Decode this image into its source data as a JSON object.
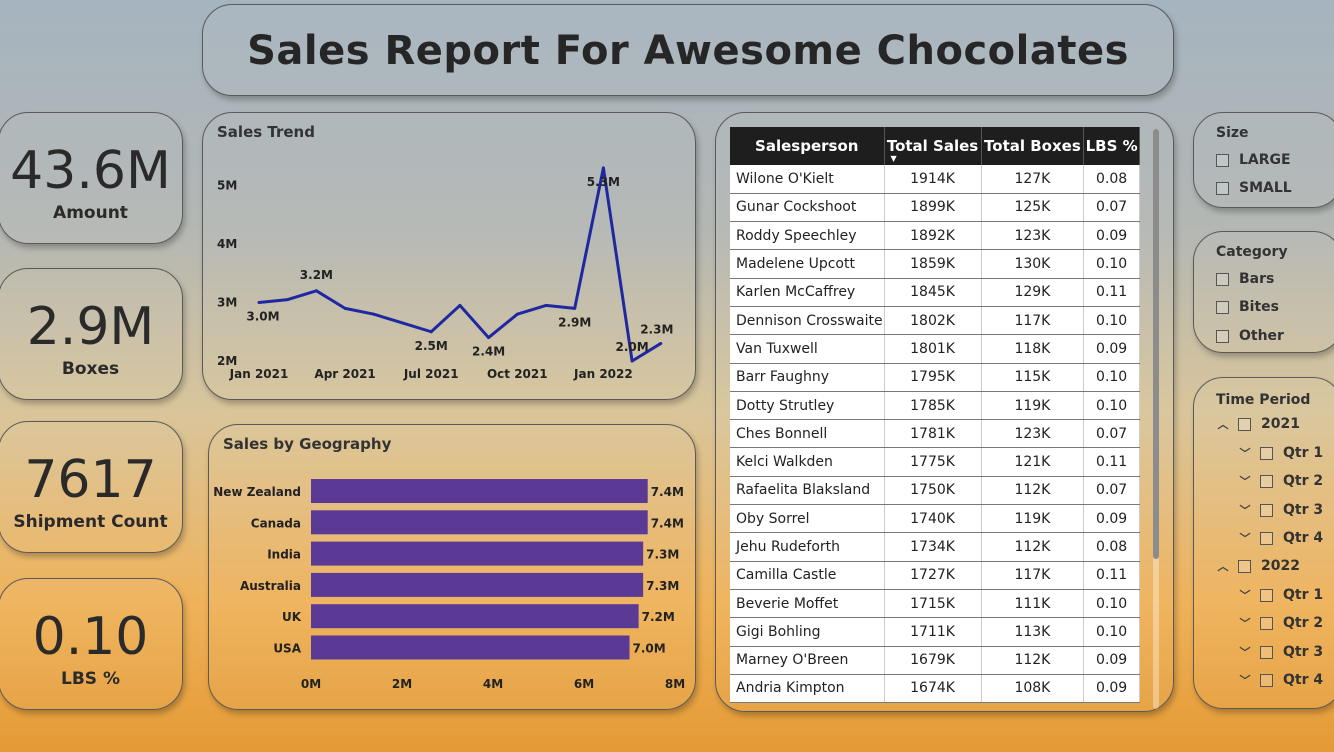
{
  "title": "Sales Report For Awesome Chocolates",
  "kpis": [
    {
      "value": "43.6M",
      "label": "Amount"
    },
    {
      "value": "2.9M",
      "label": "Boxes"
    },
    {
      "value": "7617",
      "label": "Shipment Count"
    },
    {
      "value": "0.10",
      "label": "LBS %"
    }
  ],
  "sales_trend": {
    "title": "Sales Trend"
  },
  "sales_geo": {
    "title": "Sales by Geography"
  },
  "table": {
    "headers": [
      "Salesperson",
      "Total Sales",
      "Total Boxes",
      "LBS %"
    ],
    "rows": [
      [
        "Wilone O'Kielt",
        "1914K",
        "127K",
        "0.08"
      ],
      [
        "Gunar Cockshoot",
        "1899K",
        "125K",
        "0.07"
      ],
      [
        "Roddy Speechley",
        "1892K",
        "123K",
        "0.09"
      ],
      [
        "Madelene Upcott",
        "1859K",
        "130K",
        "0.10"
      ],
      [
        "Karlen McCaffrey",
        "1845K",
        "129K",
        "0.11"
      ],
      [
        "Dennison Crosswaite",
        "1802K",
        "117K",
        "0.10"
      ],
      [
        "Van Tuxwell",
        "1801K",
        "118K",
        "0.09"
      ],
      [
        "Barr Faughny",
        "1795K",
        "115K",
        "0.10"
      ],
      [
        "Dotty Strutley",
        "1785K",
        "119K",
        "0.10"
      ],
      [
        "Ches Bonnell",
        "1781K",
        "123K",
        "0.07"
      ],
      [
        "Kelci Walkden",
        "1775K",
        "121K",
        "0.11"
      ],
      [
        "Rafaelita Blaksland",
        "1750K",
        "112K",
        "0.07"
      ],
      [
        "Oby Sorrel",
        "1740K",
        "119K",
        "0.09"
      ],
      [
        "Jehu Rudeforth",
        "1734K",
        "112K",
        "0.08"
      ],
      [
        "Camilla Castle",
        "1727K",
        "117K",
        "0.11"
      ],
      [
        "Beverie Moffet",
        "1715K",
        "111K",
        "0.10"
      ],
      [
        "Gigi Bohling",
        "1711K",
        "113K",
        "0.10"
      ],
      [
        "Marney O'Breen",
        "1679K",
        "112K",
        "0.09"
      ],
      [
        "Andria Kimpton",
        "1674K",
        "108K",
        "0.09"
      ]
    ]
  },
  "slicers": {
    "size": {
      "title": "Size",
      "options": [
        "LARGE",
        "SMALL"
      ]
    },
    "category": {
      "title": "Category",
      "options": [
        "Bars",
        "Bites",
        "Other"
      ]
    },
    "time": {
      "title": "Time Period",
      "years": [
        {
          "label": "2021",
          "quarters": [
            "Qtr 1",
            "Qtr 2",
            "Qtr 3",
            "Qtr 4"
          ]
        },
        {
          "label": "2022",
          "quarters": [
            "Qtr 1",
            "Qtr 2",
            "Qtr 3",
            "Qtr 4"
          ]
        }
      ]
    }
  },
  "colors": {
    "trend_line": "#1f28a0",
    "bars": "#5a3a94"
  },
  "chart_data": [
    {
      "type": "line",
      "title": "Sales Trend",
      "x": [
        "2021-01",
        "2021-02",
        "2021-03",
        "2021-04",
        "2021-05",
        "2021-06",
        "2021-07",
        "2021-08",
        "2021-09",
        "2021-10",
        "2021-11",
        "2021-12",
        "2022-01",
        "2022-02",
        "2022-03"
      ],
      "x_tick_labels": [
        "Jan 2021",
        "Apr 2021",
        "Jul 2021",
        "Oct 2021",
        "Jan 2022"
      ],
      "y_tick_labels": [
        "2M",
        "3M",
        "4M",
        "5M"
      ],
      "values": [
        3.0,
        3.05,
        3.2,
        2.9,
        2.8,
        2.65,
        2.5,
        2.95,
        2.4,
        2.8,
        2.95,
        2.9,
        5.3,
        2.0,
        2.3
      ],
      "data_labels": [
        {
          "i": 0,
          "text": "3.0M"
        },
        {
          "i": 2,
          "text": "3.2M"
        },
        {
          "i": 6,
          "text": "2.5M"
        },
        {
          "i": 8,
          "text": "2.4M"
        },
        {
          "i": 11,
          "text": "2.9M"
        },
        {
          "i": 12,
          "text": "5.3M"
        },
        {
          "i": 13,
          "text": "2.0M"
        },
        {
          "i": 14,
          "text": "2.3M"
        }
      ],
      "ylim": [
        2,
        5.5
      ]
    },
    {
      "type": "bar",
      "orientation": "horizontal",
      "title": "Sales by Geography",
      "categories": [
        "New Zealand",
        "Canada",
        "India",
        "Australia",
        "UK",
        "USA"
      ],
      "values": [
        7.4,
        7.4,
        7.3,
        7.3,
        7.2,
        7.0
      ],
      "data_labels": [
        "7.4M",
        "7.4M",
        "7.3M",
        "7.3M",
        "7.2M",
        "7.0M"
      ],
      "x_tick_labels": [
        "0M",
        "2M",
        "4M",
        "6M",
        "8M"
      ],
      "xlim": [
        0,
        8
      ]
    }
  ]
}
